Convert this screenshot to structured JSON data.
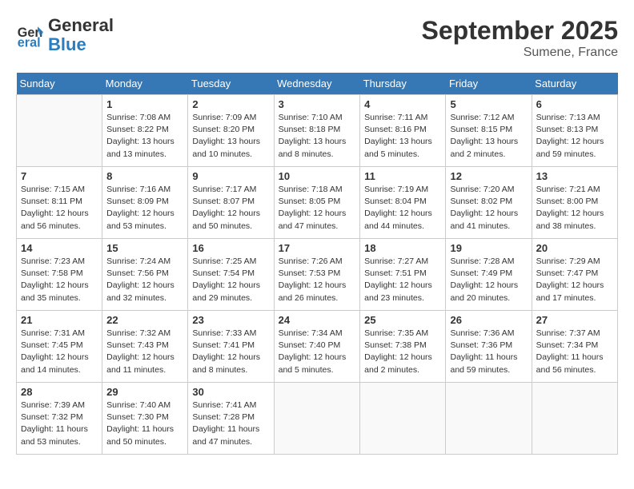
{
  "header": {
    "logo_line1": "General",
    "logo_line2": "Blue",
    "month_title": "September 2025",
    "location": "Sumene, France"
  },
  "days_of_week": [
    "Sunday",
    "Monday",
    "Tuesday",
    "Wednesday",
    "Thursday",
    "Friday",
    "Saturday"
  ],
  "weeks": [
    [
      {
        "day": "",
        "info": ""
      },
      {
        "day": "1",
        "info": "Sunrise: 7:08 AM\nSunset: 8:22 PM\nDaylight: 13 hours\nand 13 minutes."
      },
      {
        "day": "2",
        "info": "Sunrise: 7:09 AM\nSunset: 8:20 PM\nDaylight: 13 hours\nand 10 minutes."
      },
      {
        "day": "3",
        "info": "Sunrise: 7:10 AM\nSunset: 8:18 PM\nDaylight: 13 hours\nand 8 minutes."
      },
      {
        "day": "4",
        "info": "Sunrise: 7:11 AM\nSunset: 8:16 PM\nDaylight: 13 hours\nand 5 minutes."
      },
      {
        "day": "5",
        "info": "Sunrise: 7:12 AM\nSunset: 8:15 PM\nDaylight: 13 hours\nand 2 minutes."
      },
      {
        "day": "6",
        "info": "Sunrise: 7:13 AM\nSunset: 8:13 PM\nDaylight: 12 hours\nand 59 minutes."
      }
    ],
    [
      {
        "day": "7",
        "info": "Sunrise: 7:15 AM\nSunset: 8:11 PM\nDaylight: 12 hours\nand 56 minutes."
      },
      {
        "day": "8",
        "info": "Sunrise: 7:16 AM\nSunset: 8:09 PM\nDaylight: 12 hours\nand 53 minutes."
      },
      {
        "day": "9",
        "info": "Sunrise: 7:17 AM\nSunset: 8:07 PM\nDaylight: 12 hours\nand 50 minutes."
      },
      {
        "day": "10",
        "info": "Sunrise: 7:18 AM\nSunset: 8:05 PM\nDaylight: 12 hours\nand 47 minutes."
      },
      {
        "day": "11",
        "info": "Sunrise: 7:19 AM\nSunset: 8:04 PM\nDaylight: 12 hours\nand 44 minutes."
      },
      {
        "day": "12",
        "info": "Sunrise: 7:20 AM\nSunset: 8:02 PM\nDaylight: 12 hours\nand 41 minutes."
      },
      {
        "day": "13",
        "info": "Sunrise: 7:21 AM\nSunset: 8:00 PM\nDaylight: 12 hours\nand 38 minutes."
      }
    ],
    [
      {
        "day": "14",
        "info": "Sunrise: 7:23 AM\nSunset: 7:58 PM\nDaylight: 12 hours\nand 35 minutes."
      },
      {
        "day": "15",
        "info": "Sunrise: 7:24 AM\nSunset: 7:56 PM\nDaylight: 12 hours\nand 32 minutes."
      },
      {
        "day": "16",
        "info": "Sunrise: 7:25 AM\nSunset: 7:54 PM\nDaylight: 12 hours\nand 29 minutes."
      },
      {
        "day": "17",
        "info": "Sunrise: 7:26 AM\nSunset: 7:53 PM\nDaylight: 12 hours\nand 26 minutes."
      },
      {
        "day": "18",
        "info": "Sunrise: 7:27 AM\nSunset: 7:51 PM\nDaylight: 12 hours\nand 23 minutes."
      },
      {
        "day": "19",
        "info": "Sunrise: 7:28 AM\nSunset: 7:49 PM\nDaylight: 12 hours\nand 20 minutes."
      },
      {
        "day": "20",
        "info": "Sunrise: 7:29 AM\nSunset: 7:47 PM\nDaylight: 12 hours\nand 17 minutes."
      }
    ],
    [
      {
        "day": "21",
        "info": "Sunrise: 7:31 AM\nSunset: 7:45 PM\nDaylight: 12 hours\nand 14 minutes."
      },
      {
        "day": "22",
        "info": "Sunrise: 7:32 AM\nSunset: 7:43 PM\nDaylight: 12 hours\nand 11 minutes."
      },
      {
        "day": "23",
        "info": "Sunrise: 7:33 AM\nSunset: 7:41 PM\nDaylight: 12 hours\nand 8 minutes."
      },
      {
        "day": "24",
        "info": "Sunrise: 7:34 AM\nSunset: 7:40 PM\nDaylight: 12 hours\nand 5 minutes."
      },
      {
        "day": "25",
        "info": "Sunrise: 7:35 AM\nSunset: 7:38 PM\nDaylight: 12 hours\nand 2 minutes."
      },
      {
        "day": "26",
        "info": "Sunrise: 7:36 AM\nSunset: 7:36 PM\nDaylight: 11 hours\nand 59 minutes."
      },
      {
        "day": "27",
        "info": "Sunrise: 7:37 AM\nSunset: 7:34 PM\nDaylight: 11 hours\nand 56 minutes."
      }
    ],
    [
      {
        "day": "28",
        "info": "Sunrise: 7:39 AM\nSunset: 7:32 PM\nDaylight: 11 hours\nand 53 minutes."
      },
      {
        "day": "29",
        "info": "Sunrise: 7:40 AM\nSunset: 7:30 PM\nDaylight: 11 hours\nand 50 minutes."
      },
      {
        "day": "30",
        "info": "Sunrise: 7:41 AM\nSunset: 7:28 PM\nDaylight: 11 hours\nand 47 minutes."
      },
      {
        "day": "",
        "info": ""
      },
      {
        "day": "",
        "info": ""
      },
      {
        "day": "",
        "info": ""
      },
      {
        "day": "",
        "info": ""
      }
    ]
  ]
}
